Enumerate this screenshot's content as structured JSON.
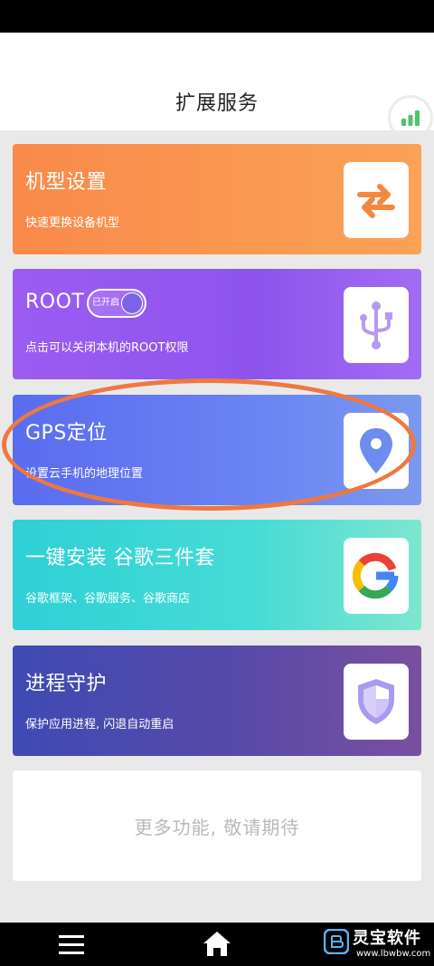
{
  "header": {
    "title": "扩展服务"
  },
  "cards": [
    {
      "title": "机型设置",
      "subtitle": "快速更换设备机型"
    },
    {
      "title": "ROOT",
      "subtitle": "点击可以关闭本机的ROOT权限",
      "toggle_label": "已开启"
    },
    {
      "title": "GPS定位",
      "subtitle": "设置云手机的地理位置"
    },
    {
      "title": "一键安装 谷歌三件套",
      "subtitle": "谷歌框架、谷歌服务、谷歌商店"
    },
    {
      "title": "进程守护",
      "subtitle": "保护应用进程, 闪退自动重启"
    }
  ],
  "more": {
    "label": "更多功能, 敬请期待"
  },
  "watermark": {
    "name": "灵宝软件",
    "url": "www.lbwbw.com"
  },
  "colors": {
    "card1": "#f98a4a",
    "card2": "#9457f0",
    "card3": "#5d74ef",
    "card4": "#3ed7d7",
    "card5": "#4a4bb0",
    "annotation": "#ef7840"
  }
}
